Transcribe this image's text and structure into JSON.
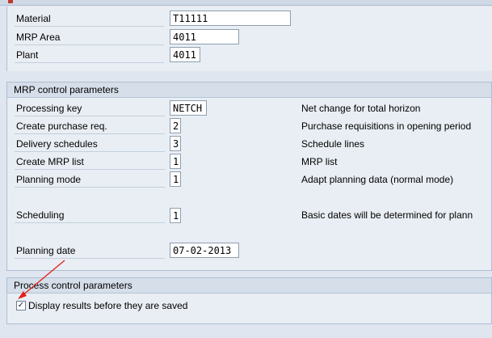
{
  "header": {
    "material": {
      "label": "Material",
      "value": "T11111"
    },
    "mrp_area": {
      "label": "MRP Area",
      "value": "4011"
    },
    "plant": {
      "label": "Plant",
      "value": "4011"
    }
  },
  "mrp_control": {
    "title": "MRP control parameters",
    "rows": [
      {
        "label": "Processing key",
        "value": "NETCH",
        "desc": "Net change for total horizon"
      },
      {
        "label": "Create purchase req.",
        "value": "2",
        "desc": "Purchase requisitions in opening period"
      },
      {
        "label": "Delivery schedules",
        "value": "3",
        "desc": "Schedule lines"
      },
      {
        "label": "Create MRP list",
        "value": "1",
        "desc": "MRP list"
      },
      {
        "label": "Planning mode",
        "value": "1",
        "desc": "Adapt planning data (normal mode)"
      },
      {
        "label": "Scheduling",
        "value": "1",
        "desc": "Basic dates will be determined for plann"
      },
      {
        "label": "Planning date",
        "value": "07-02-2013"
      }
    ]
  },
  "process_control": {
    "title": "Process control parameters",
    "display_results": {
      "label": "Display results before they are saved",
      "checked": true,
      "mark": "✓"
    }
  },
  "colors": {
    "annotation_arrow": "#e0201a"
  }
}
